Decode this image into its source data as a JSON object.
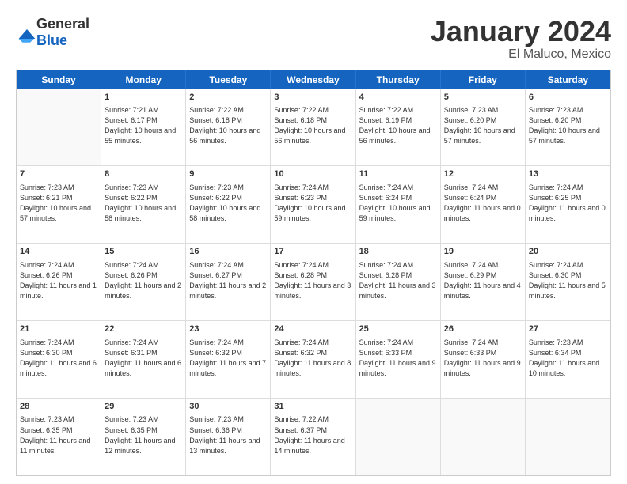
{
  "header": {
    "logo_general": "General",
    "logo_blue": "Blue",
    "month_title": "January 2024",
    "location": "El Maluco, Mexico"
  },
  "days_of_week": [
    "Sunday",
    "Monday",
    "Tuesday",
    "Wednesday",
    "Thursday",
    "Friday",
    "Saturday"
  ],
  "weeks": [
    [
      {
        "day": "",
        "sunrise": "",
        "sunset": "",
        "daylight": "",
        "empty": true
      },
      {
        "day": "1",
        "sunrise": "Sunrise: 7:21 AM",
        "sunset": "Sunset: 6:17 PM",
        "daylight": "Daylight: 10 hours and 55 minutes.",
        "empty": false
      },
      {
        "day": "2",
        "sunrise": "Sunrise: 7:22 AM",
        "sunset": "Sunset: 6:18 PM",
        "daylight": "Daylight: 10 hours and 56 minutes.",
        "empty": false
      },
      {
        "day": "3",
        "sunrise": "Sunrise: 7:22 AM",
        "sunset": "Sunset: 6:18 PM",
        "daylight": "Daylight: 10 hours and 56 minutes.",
        "empty": false
      },
      {
        "day": "4",
        "sunrise": "Sunrise: 7:22 AM",
        "sunset": "Sunset: 6:19 PM",
        "daylight": "Daylight: 10 hours and 56 minutes.",
        "empty": false
      },
      {
        "day": "5",
        "sunrise": "Sunrise: 7:23 AM",
        "sunset": "Sunset: 6:20 PM",
        "daylight": "Daylight: 10 hours and 57 minutes.",
        "empty": false
      },
      {
        "day": "6",
        "sunrise": "Sunrise: 7:23 AM",
        "sunset": "Sunset: 6:20 PM",
        "daylight": "Daylight: 10 hours and 57 minutes.",
        "empty": false
      }
    ],
    [
      {
        "day": "7",
        "sunrise": "Sunrise: 7:23 AM",
        "sunset": "Sunset: 6:21 PM",
        "daylight": "Daylight: 10 hours and 57 minutes.",
        "empty": false
      },
      {
        "day": "8",
        "sunrise": "Sunrise: 7:23 AM",
        "sunset": "Sunset: 6:22 PM",
        "daylight": "Daylight: 10 hours and 58 minutes.",
        "empty": false
      },
      {
        "day": "9",
        "sunrise": "Sunrise: 7:23 AM",
        "sunset": "Sunset: 6:22 PM",
        "daylight": "Daylight: 10 hours and 58 minutes.",
        "empty": false
      },
      {
        "day": "10",
        "sunrise": "Sunrise: 7:24 AM",
        "sunset": "Sunset: 6:23 PM",
        "daylight": "Daylight: 10 hours and 59 minutes.",
        "empty": false
      },
      {
        "day": "11",
        "sunrise": "Sunrise: 7:24 AM",
        "sunset": "Sunset: 6:24 PM",
        "daylight": "Daylight: 10 hours and 59 minutes.",
        "empty": false
      },
      {
        "day": "12",
        "sunrise": "Sunrise: 7:24 AM",
        "sunset": "Sunset: 6:24 PM",
        "daylight": "Daylight: 11 hours and 0 minutes.",
        "empty": false
      },
      {
        "day": "13",
        "sunrise": "Sunrise: 7:24 AM",
        "sunset": "Sunset: 6:25 PM",
        "daylight": "Daylight: 11 hours and 0 minutes.",
        "empty": false
      }
    ],
    [
      {
        "day": "14",
        "sunrise": "Sunrise: 7:24 AM",
        "sunset": "Sunset: 6:26 PM",
        "daylight": "Daylight: 11 hours and 1 minute.",
        "empty": false
      },
      {
        "day": "15",
        "sunrise": "Sunrise: 7:24 AM",
        "sunset": "Sunset: 6:26 PM",
        "daylight": "Daylight: 11 hours and 2 minutes.",
        "empty": false
      },
      {
        "day": "16",
        "sunrise": "Sunrise: 7:24 AM",
        "sunset": "Sunset: 6:27 PM",
        "daylight": "Daylight: 11 hours and 2 minutes.",
        "empty": false
      },
      {
        "day": "17",
        "sunrise": "Sunrise: 7:24 AM",
        "sunset": "Sunset: 6:28 PM",
        "daylight": "Daylight: 11 hours and 3 minutes.",
        "empty": false
      },
      {
        "day": "18",
        "sunrise": "Sunrise: 7:24 AM",
        "sunset": "Sunset: 6:28 PM",
        "daylight": "Daylight: 11 hours and 3 minutes.",
        "empty": false
      },
      {
        "day": "19",
        "sunrise": "Sunrise: 7:24 AM",
        "sunset": "Sunset: 6:29 PM",
        "daylight": "Daylight: 11 hours and 4 minutes.",
        "empty": false
      },
      {
        "day": "20",
        "sunrise": "Sunrise: 7:24 AM",
        "sunset": "Sunset: 6:30 PM",
        "daylight": "Daylight: 11 hours and 5 minutes.",
        "empty": false
      }
    ],
    [
      {
        "day": "21",
        "sunrise": "Sunrise: 7:24 AM",
        "sunset": "Sunset: 6:30 PM",
        "daylight": "Daylight: 11 hours and 6 minutes.",
        "empty": false
      },
      {
        "day": "22",
        "sunrise": "Sunrise: 7:24 AM",
        "sunset": "Sunset: 6:31 PM",
        "daylight": "Daylight: 11 hours and 6 minutes.",
        "empty": false
      },
      {
        "day": "23",
        "sunrise": "Sunrise: 7:24 AM",
        "sunset": "Sunset: 6:32 PM",
        "daylight": "Daylight: 11 hours and 7 minutes.",
        "empty": false
      },
      {
        "day": "24",
        "sunrise": "Sunrise: 7:24 AM",
        "sunset": "Sunset: 6:32 PM",
        "daylight": "Daylight: 11 hours and 8 minutes.",
        "empty": false
      },
      {
        "day": "25",
        "sunrise": "Sunrise: 7:24 AM",
        "sunset": "Sunset: 6:33 PM",
        "daylight": "Daylight: 11 hours and 9 minutes.",
        "empty": false
      },
      {
        "day": "26",
        "sunrise": "Sunrise: 7:24 AM",
        "sunset": "Sunset: 6:33 PM",
        "daylight": "Daylight: 11 hours and 9 minutes.",
        "empty": false
      },
      {
        "day": "27",
        "sunrise": "Sunrise: 7:23 AM",
        "sunset": "Sunset: 6:34 PM",
        "daylight": "Daylight: 11 hours and 10 minutes.",
        "empty": false
      }
    ],
    [
      {
        "day": "28",
        "sunrise": "Sunrise: 7:23 AM",
        "sunset": "Sunset: 6:35 PM",
        "daylight": "Daylight: 11 hours and 11 minutes.",
        "empty": false
      },
      {
        "day": "29",
        "sunrise": "Sunrise: 7:23 AM",
        "sunset": "Sunset: 6:35 PM",
        "daylight": "Daylight: 11 hours and 12 minutes.",
        "empty": false
      },
      {
        "day": "30",
        "sunrise": "Sunrise: 7:23 AM",
        "sunset": "Sunset: 6:36 PM",
        "daylight": "Daylight: 11 hours and 13 minutes.",
        "empty": false
      },
      {
        "day": "31",
        "sunrise": "Sunrise: 7:22 AM",
        "sunset": "Sunset: 6:37 PM",
        "daylight": "Daylight: 11 hours and 14 minutes.",
        "empty": false
      },
      {
        "day": "",
        "sunrise": "",
        "sunset": "",
        "daylight": "",
        "empty": true
      },
      {
        "day": "",
        "sunrise": "",
        "sunset": "",
        "daylight": "",
        "empty": true
      },
      {
        "day": "",
        "sunrise": "",
        "sunset": "",
        "daylight": "",
        "empty": true
      }
    ]
  ]
}
